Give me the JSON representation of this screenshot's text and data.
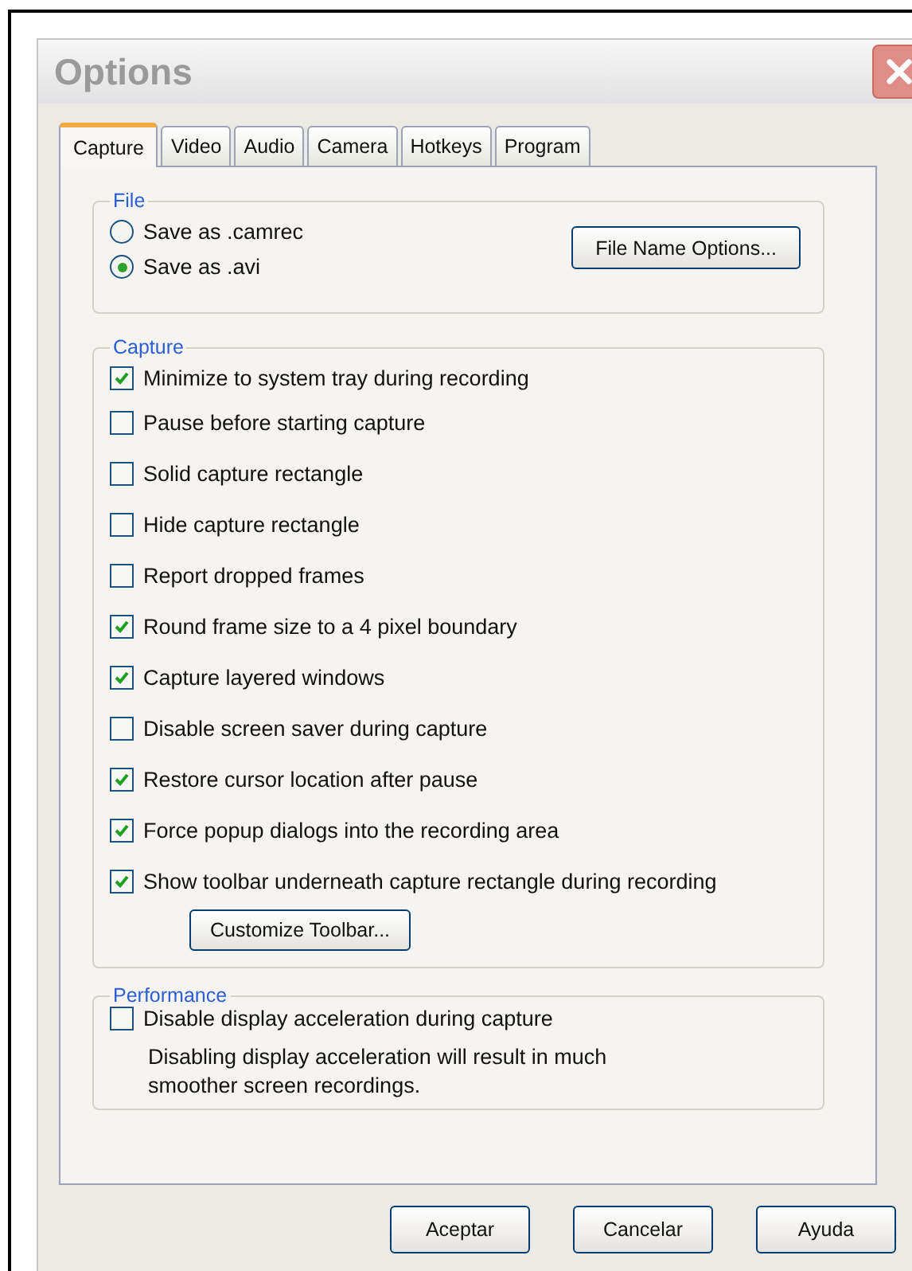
{
  "window": {
    "title": "Options"
  },
  "tabs": [
    {
      "label": "Capture",
      "selected": true
    },
    {
      "label": "Video",
      "selected": false
    },
    {
      "label": "Audio",
      "selected": false
    },
    {
      "label": "Camera",
      "selected": false
    },
    {
      "label": "Hotkeys",
      "selected": false
    },
    {
      "label": "Program",
      "selected": false
    }
  ],
  "file_group": {
    "title": "File",
    "options": [
      {
        "label": "Save as .camrec",
        "selected": false
      },
      {
        "label": "Save as .avi",
        "selected": true
      }
    ],
    "button": "File Name Options..."
  },
  "capture_group": {
    "title": "Capture",
    "options": [
      {
        "label": "Minimize to system tray during recording",
        "checked": true
      },
      {
        "label": "Pause before starting capture",
        "checked": false
      },
      {
        "label": "Solid capture rectangle",
        "checked": false
      },
      {
        "label": "Hide capture rectangle",
        "checked": false
      },
      {
        "label": "Report dropped frames",
        "checked": false
      },
      {
        "label": "Round frame size to a 4 pixel boundary",
        "checked": true
      },
      {
        "label": "Capture layered windows",
        "checked": true
      },
      {
        "label": "Disable screen saver during capture",
        "checked": false
      },
      {
        "label": "Restore cursor location after pause",
        "checked": true
      },
      {
        "label": "Force popup dialogs into the recording area",
        "checked": true
      },
      {
        "label": "Show toolbar underneath capture rectangle during recording",
        "checked": true
      }
    ],
    "button": "Customize Toolbar..."
  },
  "performance_group": {
    "title": "Performance",
    "option": {
      "label": "Disable display acceleration during capture",
      "checked": false
    },
    "note": "Disabling display acceleration will result in much smoother screen recordings."
  },
  "buttons": [
    "Aceptar",
    "Cancelar",
    "Ayuda"
  ]
}
